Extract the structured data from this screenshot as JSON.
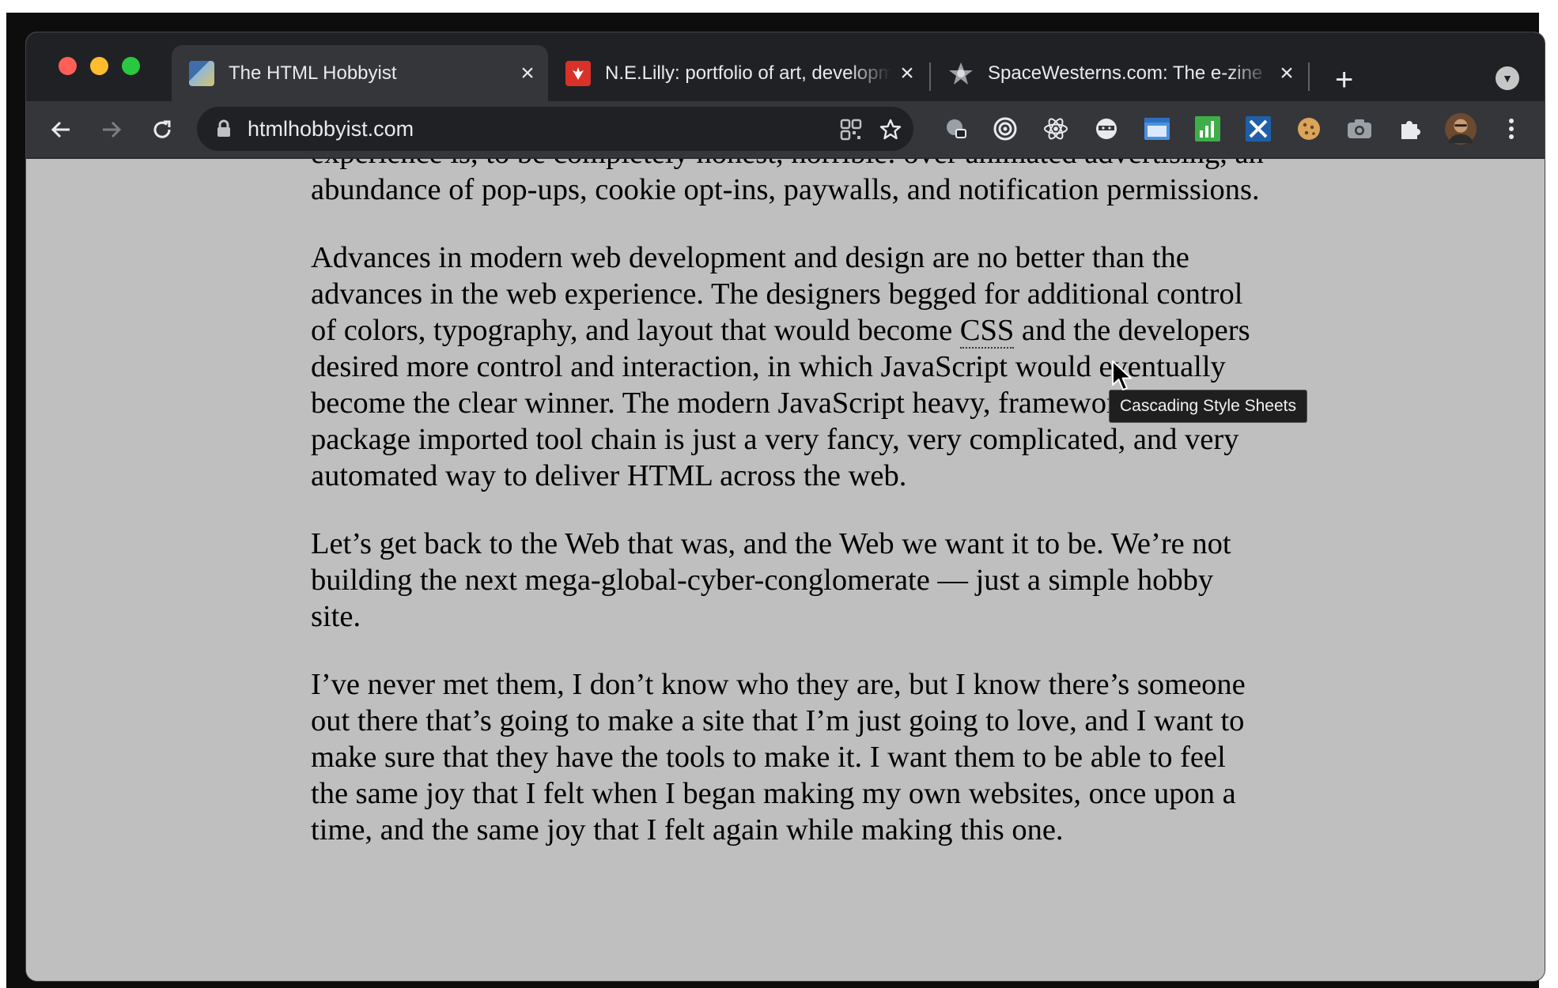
{
  "browser": {
    "tabs": [
      {
        "title": "The HTML Hobbyist",
        "active": true
      },
      {
        "title": "N.E.Lilly: portfolio of art, development",
        "active": false
      },
      {
        "title": "SpaceWesterns.com: The e-zine",
        "active": false
      }
    ],
    "url": "htmlhobbyist.com",
    "extension_icons": [
      "bookmark-manager-icon",
      "target-icon",
      "react-icon",
      "ninja-icon",
      "window-icon",
      "analytics-icon",
      "x-icon",
      "cookie-icon",
      "camera-icon",
      "puzzle-piece-icon"
    ]
  },
  "article": {
    "p0": "experience is, to be completely honest, horrible: over animated advertising, an abundance of pop-ups, cookie opt-ins, paywalls, and notification permissions.",
    "p1_before": "Advances in modern web development and design are no better than the advances in the web experience. The designers begged for additional control of colors, typography, and layout that would become ",
    "p1_abbr": "CSS",
    "p1_after": " and the developers desired more control and interaction, in which JavaScript would eventually become the clear winner. The modern JavaScript heavy, framework driven, package imported tool chain is just a very fancy, very complicated, and very automated way to deliver HTML across the web.",
    "p2": "Let’s get back to the Web that was, and the Web we want it to be. We’re not building the next mega-global-cyber-conglomerate — just a simple hobby site.",
    "p3": "I’ve never met them, I don’t know who they are, but I know there’s someone out there that’s going to make a site that I’m just going to love, and I want to make sure that they have the tools to make it. I want them to be able to feel the same joy that I felt when I began making my own websites, once upon a time, and the same joy that I felt again while making this one."
  },
  "tooltip": {
    "text": "Cascading Style Sheets"
  },
  "colors": {
    "tabstrip": "#202124",
    "toolbar": "#35363a",
    "page_background": "#bfbfbf",
    "close_light": "#ff5f57",
    "minimize_light": "#febc2e",
    "zoom_light": "#28c840"
  }
}
